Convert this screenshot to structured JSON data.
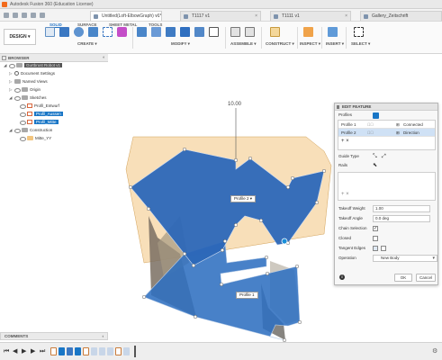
{
  "app": {
    "title": "Autodesk Fusion 360 (Education License)"
  },
  "tabs": [
    {
      "label": "Untitled(Loft-ElbowGraph) v1*",
      "active": true
    },
    {
      "label": "T1117 v1",
      "active": false
    },
    {
      "label": "T1111 v1",
      "active": false
    },
    {
      "label": "Gallery_Zeitschrift",
      "active": false
    }
  ],
  "toolbar": {
    "workspace": "DESIGN ▾",
    "ws_tabs": [
      "SOLID",
      "SURFACE",
      "SHEET METAL",
      "TOOLS"
    ],
    "groups": [
      "CREATE ▾",
      "MODIFY ▾",
      "ASSEMBLE ▾",
      "CONSTRUCT ▾",
      "INSPECT ▾",
      "INSERT ▾",
      "SELECT ▾"
    ]
  },
  "browser": {
    "header": "BROWSER",
    "nodes": [
      {
        "label": "Gurtbrust Robot v1"
      },
      {
        "label": "Document Settings"
      },
      {
        "label": "Named Views"
      },
      {
        "label": "Origin"
      },
      {
        "label": "Sketches"
      },
      {
        "label": "Profil_Entwurf"
      },
      {
        "label": "Profil_Aussen"
      },
      {
        "label": "Profil_Mitte"
      },
      {
        "label": "Construction"
      },
      {
        "label": "Mitte_YY"
      }
    ]
  },
  "comments": {
    "label": "COMMENTS"
  },
  "viewport": {
    "dimension": "10.00",
    "profile2_label": "Profile 2 ▾",
    "profile1_label": "Profile 1"
  },
  "panel": {
    "title": "EDIT FEATURE",
    "profiles_label": "Profiles",
    "profile_rows": [
      {
        "name": "Profile 1",
        "mode": "Connected"
      },
      {
        "name": "Profile 2",
        "mode": "Direction"
      }
    ],
    "add_remove": "+ ×",
    "guide_type_label": "Guide Type",
    "rails_label": "Rails",
    "rails_add_remove": "+ ×",
    "takeoff_weight_label": "Takeoff Weight",
    "takeoff_weight_value": "1.00",
    "takeoff_angle_label": "Takeoff Angle",
    "takeoff_angle_value": "0.0 deg",
    "chain_selection_label": "Chain Selection",
    "closed_label": "Closed",
    "tangent_edges_label": "Tangent Edges",
    "operation_label": "Operation",
    "operation_value": "New Body",
    "ok_label": "OK",
    "cancel_label": "Cancel",
    "info_icon": "info-icon"
  },
  "colors": {
    "accent": "#1976c6",
    "sketch_plane": "#f2c57f",
    "face_blue": "#2f6fc0"
  }
}
